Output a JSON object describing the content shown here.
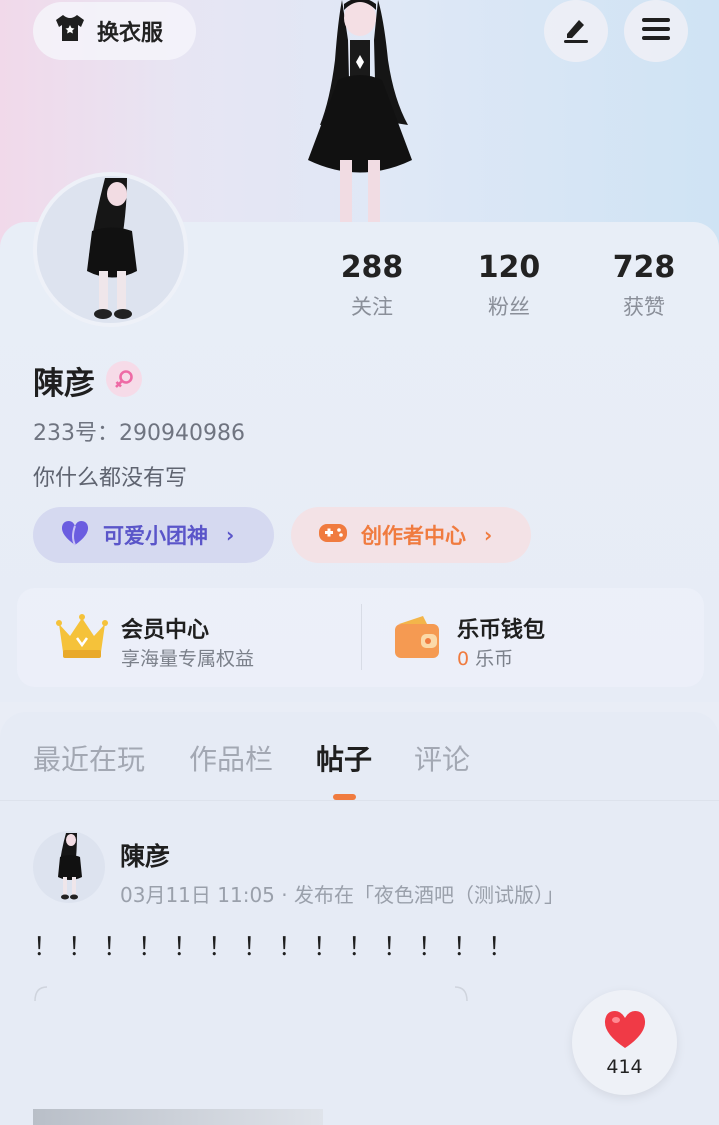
{
  "header": {
    "outfit_label": "换衣服",
    "icons": {
      "outfit": "tshirt-icon",
      "edit": "pen-icon",
      "menu": "menu-icon"
    }
  },
  "profile": {
    "name": "陳彦",
    "gender_icon": "female-icon",
    "uid": "233号：290940986",
    "bio": "你什么都没有写",
    "stats": [
      {
        "num": "288",
        "label": "关注"
      },
      {
        "num": "120",
        "label": "粉丝"
      },
      {
        "num": "728",
        "label": "获赞"
      }
    ],
    "tags": [
      {
        "label": "可爱小团神",
        "icon": "heart-badge-icon",
        "color": "#5a55c9"
      },
      {
        "label": "创作者中心",
        "icon": "gamepad-icon",
        "color": "#f07b3f"
      }
    ]
  },
  "vip": {
    "member": {
      "title": "会员中心",
      "subtitle": "享海量专属权益",
      "icon": "crown-icon"
    },
    "wallet": {
      "title": "乐币钱包",
      "amount": "0",
      "unit": "乐币",
      "icon": "wallet-icon",
      "amount_color": "#f07b3f"
    }
  },
  "tabs": [
    {
      "label": "最近在玩",
      "active": false
    },
    {
      "label": "作品栏",
      "active": false
    },
    {
      "label": "帖子",
      "active": true
    },
    {
      "label": "评论",
      "active": false
    }
  ],
  "post": {
    "author": "陳彦",
    "meta": "03月11日 11:05 · 发布在「夜色酒吧（测试版）」",
    "body": "！！！！！！！！！！！！！！",
    "likes": "414"
  },
  "colors": {
    "accent": "#f07b3f",
    "purple": "#5a55c9",
    "like": "#f03a46"
  }
}
